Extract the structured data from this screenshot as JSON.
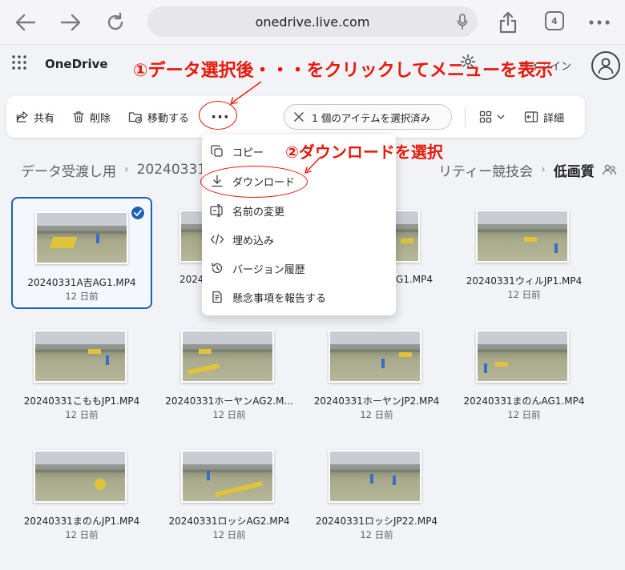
{
  "browser": {
    "url": "onedrive.live.com",
    "tab_count": "4"
  },
  "app": {
    "brand": "OneDrive",
    "signin": "サインイン"
  },
  "annotations": {
    "step1": "①データ選択後・・・をクリックしてメニューを表示",
    "step2": "②ダウンロードを選択"
  },
  "toolbar": {
    "share": "共有",
    "delete": "削除",
    "move": "移動する",
    "more": "···",
    "selection": "1 個のアイテムを選択済み",
    "details": "詳細"
  },
  "breadcrumb": {
    "items": [
      "データ受渡し用",
      "20240331",
      "リティー競技会"
    ],
    "current": "低画質"
  },
  "context_menu": {
    "items": [
      {
        "label": "コピー",
        "icon": "copy-icon"
      },
      {
        "label": "ダウンロード",
        "icon": "download-icon"
      },
      {
        "label": "名前の変更",
        "icon": "rename-icon"
      },
      {
        "label": "埋め込み",
        "icon": "embed-icon"
      },
      {
        "label": "バージョン履歴",
        "icon": "history-icon"
      },
      {
        "label": "懸念事項を報告する",
        "icon": "report-icon"
      }
    ]
  },
  "files": [
    {
      "name": "20240331A吉AG1.MP4",
      "date": "12 日前",
      "selected": true
    },
    {
      "name": "2024",
      "date": "",
      "selected": false
    },
    {
      "name": "AG1.MP4",
      "date": "",
      "selected": false
    },
    {
      "name": "20240331ウィルJP1.MP4",
      "date": "12 日前",
      "selected": false
    },
    {
      "name": "20240331こももJP1.MP4",
      "date": "12 日前",
      "selected": false
    },
    {
      "name": "20240331ホーヤンAG2.M...",
      "date": "12 日前",
      "selected": false
    },
    {
      "name": "20240331ホーヤンJP2.MP4",
      "date": "12 日前",
      "selected": false
    },
    {
      "name": "20240331まのんAG1.MP4",
      "date": "12 日前",
      "selected": false
    },
    {
      "name": "20240331まのんJP1.MP4",
      "date": "12 日前",
      "selected": false
    },
    {
      "name": "20240331ロッシAG2.MP4",
      "date": "12 日前",
      "selected": false
    },
    {
      "name": "20240331ロッシJP22.MP4",
      "date": "12 日前",
      "selected": false
    }
  ],
  "colors": {
    "accent": "#1d62b8",
    "annotation": "#e8190c",
    "background": "#f1f3f7"
  }
}
